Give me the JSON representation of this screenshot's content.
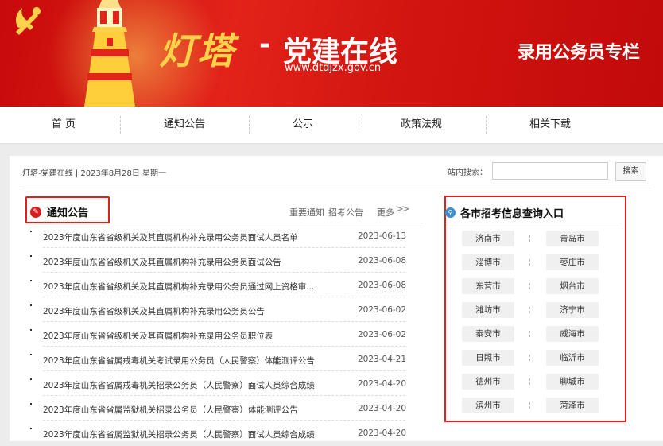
{
  "header": {
    "logo_main": "灯塔",
    "logo_dash": "-",
    "logo_sub": "党建在线",
    "logo_url": "www.dtdjzx.gov.cn",
    "special_title": "录用公务员专栏"
  },
  "nav": {
    "items": [
      {
        "label": "首 页"
      },
      {
        "label": "通知公告"
      },
      {
        "label": "公示"
      },
      {
        "label": "政策法规"
      },
      {
        "label": "相关下载"
      }
    ]
  },
  "breadcrumb": "灯塔-党建在线 | 2023年8月28日 星期一",
  "search": {
    "label": "站内搜索：",
    "value": "",
    "button": "搜索"
  },
  "notices": {
    "title": "通知公告",
    "tabs": [
      "重要通知",
      "招考公告",
      "更多"
    ],
    "items": [
      {
        "title": "2023年度山东省省级机关及其直属机构补充录用公务员面试人员名单",
        "date": "2023-06-13"
      },
      {
        "title": "2023年度山东省省级机关及其直属机构补充录用公务员面试公告",
        "date": "2023-06-08"
      },
      {
        "title": "2023年度山东省省级机关及其直属机构补充录用公务员通过网上资格审...",
        "date": "2023-06-08"
      },
      {
        "title": "2023年度山东省省级机关及其直属机构补充录用公务员公告",
        "date": "2023-06-02"
      },
      {
        "title": "2023年度山东省省级机关及其直属机构补充录用公务员职位表",
        "date": "2023-06-02"
      },
      {
        "title": "2023年度山东省省属戒毒机关考试录用公务员（人民警察）体能测评公告",
        "date": "2023-04-21"
      },
      {
        "title": "2023年度山东省省属戒毒机关招录公务员（人民警察）面试人员综合成绩",
        "date": "2023-04-20"
      },
      {
        "title": "2023年度山东省省属监狱机关招录公务员（人民警察）体能测评公告",
        "date": "2023-04-20"
      },
      {
        "title": "2023年度山东省省属监狱机关招录公务员（人民警察）面试人员综合成绩",
        "date": "2023-04-20"
      }
    ]
  },
  "cities": {
    "title": "各市招考信息查询入口",
    "items": [
      "济南市",
      "青岛市",
      "淄博市",
      "枣庄市",
      "东营市",
      "烟台市",
      "潍坊市",
      "济宁市",
      "泰安市",
      "威海市",
      "日照市",
      "临沂市",
      "德州市",
      "聊城市",
      "滨州市",
      "菏泽市"
    ]
  },
  "colors": {
    "banner_red": "#e2231a",
    "accent_red": "#e0201a",
    "logo_gold": "#ffd24a"
  }
}
